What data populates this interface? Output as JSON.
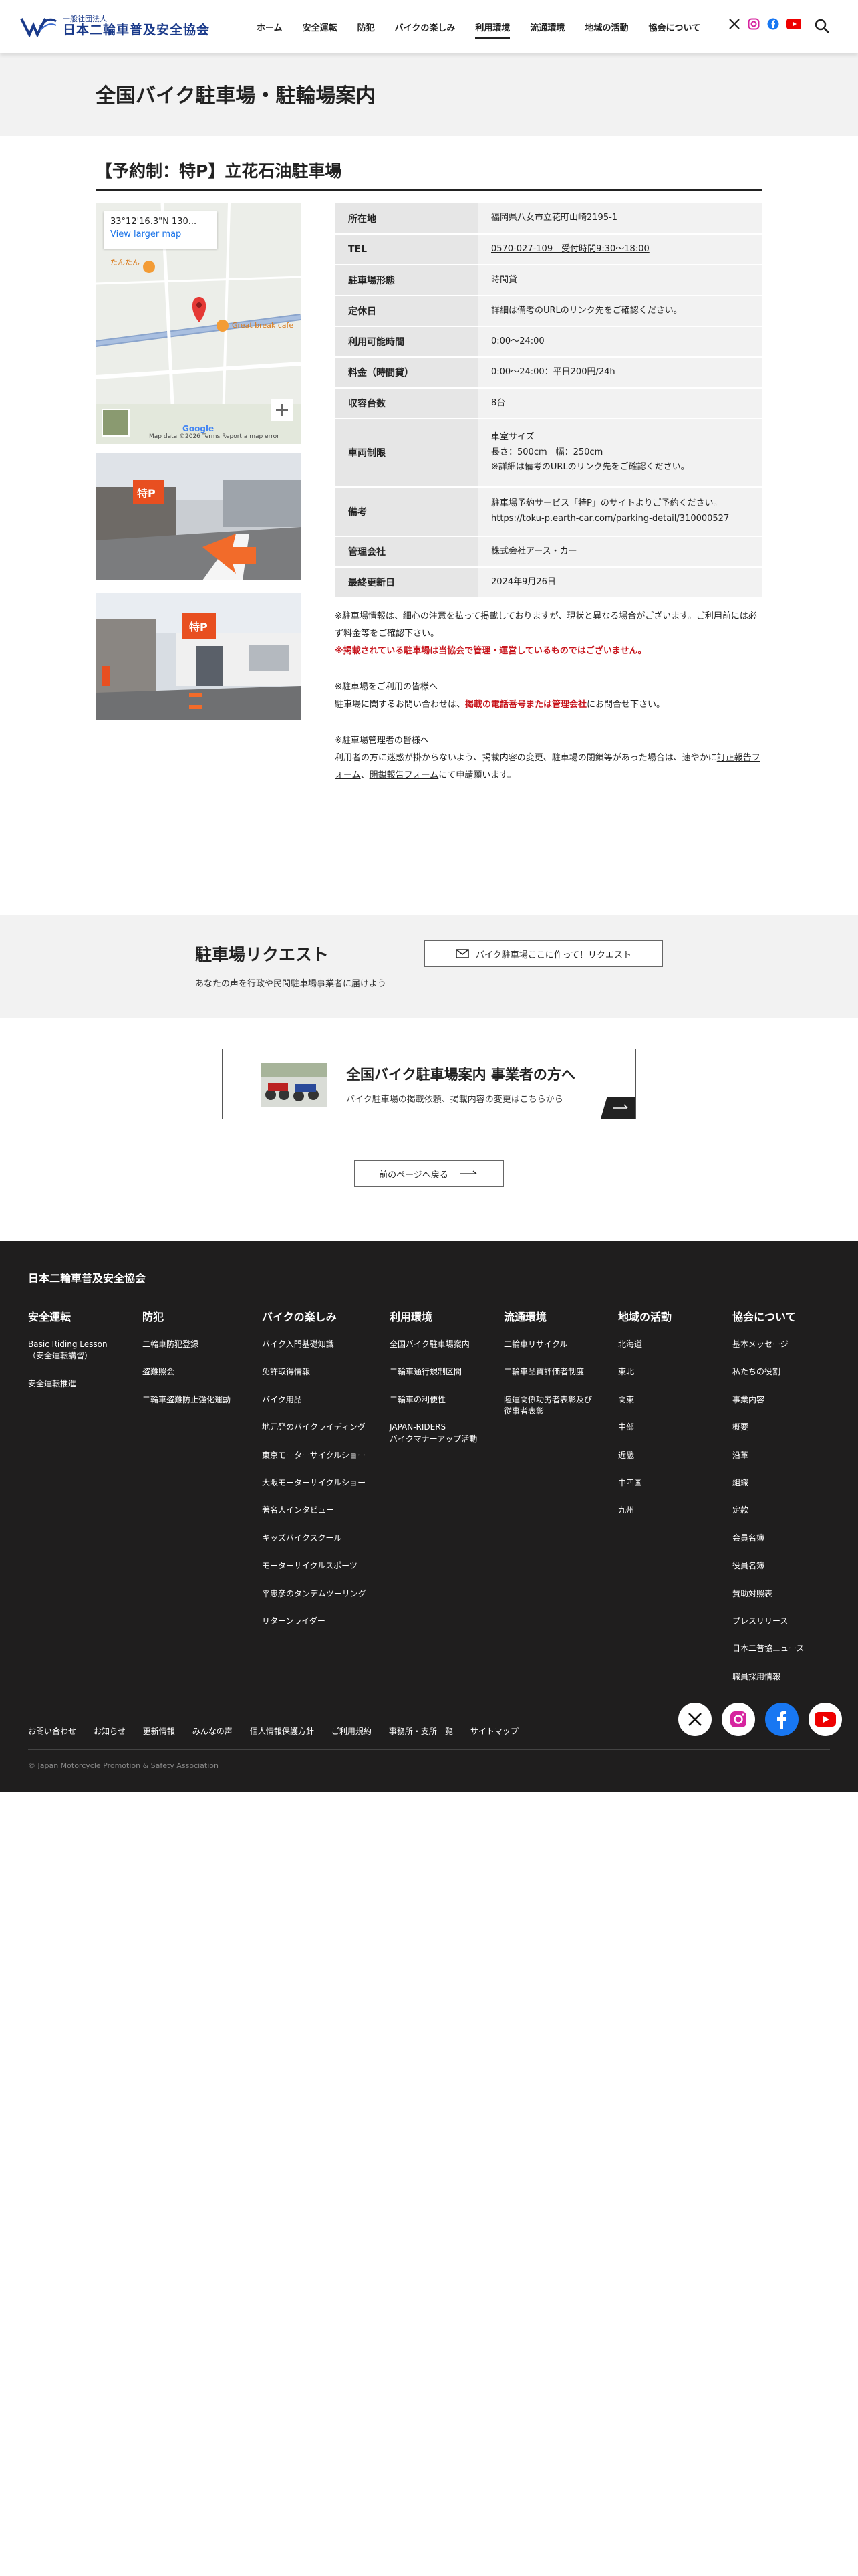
{
  "header": {
    "logo_sub": "一般社団法人",
    "logo_main": "日本二輪車普及安全協会",
    "nav": [
      {
        "label": "ホーム"
      },
      {
        "label": "安全運転"
      },
      {
        "label": "防犯"
      },
      {
        "label": "バイクの楽しみ"
      },
      {
        "label": "利用環境"
      },
      {
        "label": "流通環境"
      },
      {
        "label": "地域の活動"
      },
      {
        "label": "協会について"
      }
    ],
    "active_index": 4,
    "social_icons": [
      "x-icon",
      "instagram-icon",
      "facebook-icon",
      "youtube-icon"
    ],
    "search_icon": "search-icon"
  },
  "page": {
    "title": "全国バイク駐車場・駐輪場案内",
    "subtitle": "【予約制：特P】立花石油駐車場"
  },
  "map": {
    "coord": "33°12'16.3\"N 130...",
    "link": "View larger map",
    "label_1": "たんたん",
    "label_2": "Great break cafe",
    "footer": "Map data ©2026   Terms   Report a map error",
    "logo": "Google"
  },
  "photos": {
    "badge": "特P"
  },
  "info": {
    "rows": [
      {
        "label": "所在地",
        "value": "福岡県八女市立花町山崎2195-1"
      },
      {
        "label": "TEL",
        "value": "0570-027-109　受付時間9:30～18:00"
      },
      {
        "label": "駐車場形態",
        "value": "時間貸"
      },
      {
        "label": "定休日",
        "value": "詳細は備考のURLのリンク先をご確認ください。"
      },
      {
        "label": "利用可能時間",
        "value": "0:00～24:00"
      },
      {
        "label": "料金（時間貸）",
        "value": "0:00～24:00：平日200円/24h"
      },
      {
        "label": "収容台数",
        "value": "8台"
      },
      {
        "label": "車両制限",
        "value_lines": [
          "車室サイズ",
          "長さ：500cm　幅：250cm",
          "※詳細は備考のURLのリンク先をご確認ください。"
        ]
      },
      {
        "label": "備考",
        "value_lines": [
          "駐車場予約サービス「特P」のサイトよりご予約ください。",
          "https://toku-p.earth-car.com/parking-detail/310000527"
        ]
      },
      {
        "label": "管理会社",
        "value": "株式会社アース・カー"
      },
      {
        "label": "最終更新日",
        "value": "2024年9月26日"
      }
    ]
  },
  "notes": {
    "p1": "※駐車場情報は、細心の注意を払って掲載しておりますが、現状と異なる場合がございます。ご利用前には必ず料金等をご確認下さい。",
    "p1_red": "※掲載されている駐車場は当協会で管理・運営しているものではございません。",
    "p2_head": "※駐車場をご利用の皆様へ",
    "p2_a": "駐車場に関するお問い合わせは、",
    "p2_red": "掲載の電話番号または管理会社",
    "p2_b": "にお問合せ下さい。",
    "p3_head": "※駐車場管理者の皆様へ",
    "p3_a": "利用者の方に迷惑が掛からないよう、掲載内容の変更、駐車場の閉鎖等があった場合は、速やかに",
    "p3_link1": "訂正報告フォーム",
    "p3_sep": "、",
    "p3_link2": "閉鎖報告フォーム",
    "p3_b": "にて申請願います。"
  },
  "request": {
    "title": "駐車場リクエスト",
    "desc": "あなたの声を行政や民間駐車場事業者に届けよう",
    "button": "バイク駐車場ここに作って！リクエスト"
  },
  "business": {
    "title": "全国バイク駐車場案内 事業者の方へ",
    "desc": "バイク駐車場の掲載依頼、掲載内容の変更はこちらから"
  },
  "back_button": "前のページへ戻る",
  "footer": {
    "org": "日本二輪車普及安全協会",
    "columns": [
      {
        "head": "安全運転",
        "items": [
          "Basic Riding Lesson\n（安全運転講習）",
          "安全運転推進"
        ]
      },
      {
        "head": "防犯",
        "items": [
          "二輪車防犯登録",
          "盗難照会",
          "二輪車盗難防止強化運動"
        ]
      },
      {
        "head": "バイクの楽しみ",
        "items": [
          "バイク入門基礎知識",
          "免許取得情報",
          "バイク用品",
          "地元発のバイクライディング",
          "東京モーターサイクルショー",
          "大阪モーターサイクルショー",
          "著名人インタビュー",
          "キッズバイクスクール",
          "モーターサイクルスポーツ",
          "平忠彦のタンデムツーリング",
          "リターンライダー"
        ]
      },
      {
        "head": "利用環境",
        "items": [
          "全国バイク駐車場案内",
          "二輪車通行規制区間",
          "二輪車の利便性",
          "JAPAN-RIDERS\nバイクマナーアップ活動"
        ]
      },
      {
        "head": "流通環境",
        "items": [
          "二輪車リサイクル",
          "二輪車品質評価者制度",
          "陸運関係功労者表彰及び\n従事者表彰"
        ]
      },
      {
        "head": "地域の活動",
        "items": [
          "北海道",
          "東北",
          "関東",
          "中部",
          "近畿",
          "中四国",
          "九州"
        ]
      },
      {
        "head": "協会について",
        "items": [
          "基本メッセージ",
          "私たちの役割",
          "事業内容",
          "概要",
          "沿革",
          "組織",
          "定款",
          "会員名簿",
          "役員名簿",
          "賛助対照表",
          "プレスリリース",
          "日本二普協ニュース",
          "職員採用情報"
        ]
      }
    ],
    "bottom_links": [
      "お問い合わせ",
      "お知らせ",
      "更新情報",
      "みんなの声",
      "個人情報保護方針",
      "ご利用規約",
      "事務所・支所一覧",
      "サイトマップ"
    ],
    "social_icons": [
      "x-icon",
      "instagram-icon",
      "facebook-icon",
      "youtube-icon"
    ],
    "copyright": "© Japan Motorcycle Promotion & Safety Association",
    "colors": {
      "bg": "#1f1e1e",
      "accent_red": "#c8161d",
      "brand_blue": "#1a3a8a"
    }
  }
}
